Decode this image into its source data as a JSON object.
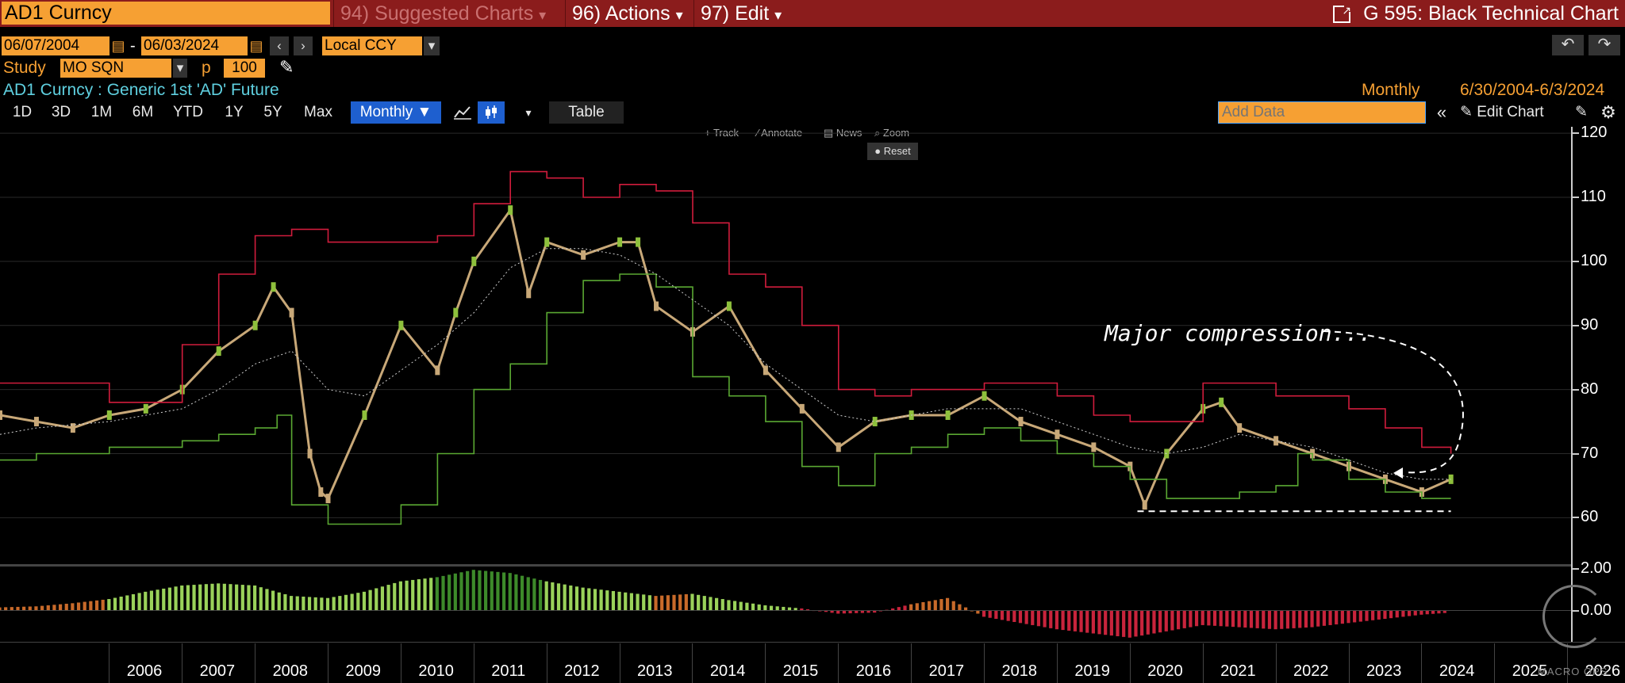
{
  "header": {
    "ticker": "AD1 Curncy",
    "suggested": "94) Suggested Charts",
    "actions": "96) Actions",
    "edit": "97) Edit",
    "chart_id": "G 595: Black Technical Chart",
    "arrow_down": "▾"
  },
  "range": {
    "start": "06/07/2004",
    "dash": "-",
    "end": "06/03/2024",
    "currency": "Local CCY",
    "prev": "‹",
    "next": "›"
  },
  "study": {
    "label": "Study",
    "value": "MO SQN",
    "p_label": "p",
    "p_value": "100"
  },
  "security": {
    "description": "AD1 Curncy : Generic 1st 'AD' Future",
    "period": "Monthly",
    "period_range": "6/30/2004-6/3/2024"
  },
  "toolbar": {
    "ranges": [
      "1D",
      "3D",
      "1M",
      "6M",
      "YTD",
      "1Y",
      "5Y",
      "Max"
    ],
    "frequency": "Monthly ▼",
    "table": "Table",
    "add_data_placeholder": "Add Data",
    "edit_chart": "Edit Chart"
  },
  "chart_tools": {
    "track": "Track",
    "annotate": "Annotate",
    "news": "News",
    "zoom": "Zoom",
    "reset": "Reset"
  },
  "annotation": "Major compression...",
  "watermark": "MACRO OPS",
  "colors": {
    "upper_band": "#d01c3c",
    "lower_band": "#5aa832",
    "candle_body": "#c8a878",
    "candle_up": "#8ec03c",
    "osc_green": "#9ad25a",
    "osc_dark_green": "#3d8a2a",
    "osc_orange": "#c86a2a",
    "osc_red": "#c8243c",
    "accent_orange": "#f6a033"
  },
  "chart_data": [
    {
      "type": "line",
      "title": "AD1 Curncy : Generic 1st 'AD' Future",
      "x_label": "",
      "y_label": "",
      "ylim": [
        53,
        121
      ],
      "y_ticks": [
        60,
        70,
        80,
        90,
        100,
        110,
        120
      ],
      "x_ticks": [
        "2006",
        "2007",
        "2008",
        "2009",
        "2010",
        "2011",
        "2012",
        "2013",
        "2014",
        "2015",
        "2016",
        "2017",
        "2018",
        "2019",
        "2020",
        "2021",
        "2022",
        "2023",
        "2024",
        "2025",
        "2026"
      ],
      "series": [
        {
          "kind": "close",
          "x": [
            2004.5,
            2005,
            2005.5,
            2006,
            2006.5,
            2007,
            2007.5,
            2008,
            2008.25,
            2008.5,
            2008.75,
            2008.9,
            2009,
            2009.5,
            2010,
            2010.5,
            2010.75,
            2011,
            2011.5,
            2011.75,
            2012,
            2012.5,
            2013,
            2013.25,
            2013.5,
            2014,
            2014.5,
            2015,
            2015.5,
            2016,
            2016.5,
            2017,
            2017.5,
            2018,
            2018.5,
            2019,
            2019.5,
            2020,
            2020.2,
            2020.5,
            2021,
            2021.25,
            2021.5,
            2022,
            2022.5,
            2023,
            2023.5,
            2024,
            2024.4
          ],
          "values": [
            76,
            75,
            74,
            76,
            77,
            80,
            86,
            90,
            96,
            92,
            70,
            64,
            63,
            76,
            90,
            83,
            92,
            100,
            108,
            95,
            103,
            101,
            103,
            103,
            93,
            89,
            93,
            83,
            77,
            71,
            75,
            76,
            76,
            79,
            75,
            73,
            71,
            68,
            62,
            70,
            77,
            78,
            74,
            72,
            70,
            68,
            66,
            64,
            66
          ]
        },
        {
          "kind": "upper_band",
          "x": [
            2004.5,
            2006,
            2007,
            2007.5,
            2008,
            2008.5,
            2009,
            2010,
            2010.5,
            2011,
            2011.5,
            2012,
            2012.5,
            2013,
            2013.5,
            2014,
            2014.5,
            2015,
            2015.5,
            2016,
            2016.5,
            2017,
            2017.5,
            2018,
            2018.5,
            2019,
            2019.5,
            2020,
            2020.5,
            2021,
            2021.5,
            2022,
            2022.5,
            2023,
            2023.5,
            2024,
            2024.4
          ],
          "values": [
            81,
            78,
            87,
            98,
            104,
            105,
            103,
            103,
            104,
            109,
            114,
            113,
            110,
            112,
            111,
            106,
            98,
            96,
            90,
            80,
            79,
            80,
            80,
            81,
            81,
            79,
            76,
            75,
            75,
            81,
            81,
            79,
            79,
            77,
            74,
            71,
            70
          ]
        },
        {
          "kind": "lower_band",
          "x": [
            2004.5,
            2005,
            2006,
            2007,
            2007.5,
            2008,
            2008.3,
            2008.5,
            2009,
            2009.5,
            2010,
            2010.5,
            2011,
            2011.5,
            2012,
            2012.5,
            2013,
            2013.5,
            2014,
            2014.5,
            2015,
            2015.5,
            2016,
            2016.5,
            2017,
            2017.5,
            2018,
            2018.5,
            2019,
            2019.5,
            2020,
            2020.5,
            2021,
            2021.5,
            2022,
            2022.3,
            2022.5,
            2023,
            2023.5,
            2024,
            2024.4
          ],
          "values": [
            69,
            70,
            71,
            72,
            73,
            74,
            76,
            62,
            59,
            59,
            62,
            70,
            80,
            84,
            92,
            97,
            98,
            96,
            82,
            79,
            75,
            68,
            65,
            70,
            71,
            73,
            74,
            72,
            70,
            68,
            66,
            63,
            63,
            64,
            65,
            70,
            69,
            66,
            64,
            63,
            63
          ]
        },
        {
          "kind": "moving_average",
          "x": [
            2004.5,
            2005,
            2006,
            2007,
            2007.5,
            2008,
            2008.5,
            2009,
            2009.5,
            2010,
            2010.5,
            2011,
            2011.5,
            2012,
            2012.5,
            2013,
            2013.5,
            2014,
            2014.5,
            2015,
            2015.5,
            2016,
            2016.5,
            2017,
            2017.5,
            2018,
            2018.5,
            2019,
            2019.5,
            2020,
            2020.5,
            2021,
            2021.5,
            2022,
            2022.5,
            2023,
            2023.5,
            2024,
            2024.4
          ],
          "values": [
            73,
            74,
            75,
            77,
            80,
            84,
            86,
            80,
            79,
            83,
            87,
            92,
            99,
            102,
            102,
            101,
            98,
            94,
            90,
            84,
            80,
            76,
            75,
            76,
            77,
            77,
            77,
            75,
            73,
            71,
            70,
            71,
            73,
            72,
            71,
            69,
            67,
            66,
            66
          ]
        },
        {
          "kind": "annotation_support",
          "x": [
            2020.1,
            2024.4
          ],
          "values": [
            61,
            61
          ]
        }
      ]
    },
    {
      "type": "bar",
      "title": "",
      "ylim": [
        -1.5,
        2.3
      ],
      "y_ticks": [
        2.0,
        0.0
      ],
      "y_tick_labels": [
        "2.00",
        "0.00"
      ],
      "x": [
        2004.5,
        2005,
        2005.5,
        2006,
        2006.5,
        2007,
        2007.5,
        2008,
        2008.5,
        2009,
        2009.5,
        2010,
        2010.5,
        2011,
        2011.5,
        2012,
        2012.5,
        2013,
        2013.5,
        2014,
        2014.5,
        2015,
        2015.5,
        2016,
        2016.5,
        2017,
        2017.5,
        2018,
        2018.5,
        2019,
        2019.5,
        2020,
        2020.5,
        2021,
        2021.5,
        2022,
        2022.5,
        2023,
        2023.5,
        2024,
        2024.4
      ],
      "values": [
        0.15,
        0.2,
        0.35,
        0.55,
        0.9,
        1.2,
        1.3,
        1.2,
        0.7,
        0.6,
        0.9,
        1.4,
        1.6,
        1.95,
        1.8,
        1.4,
        1.1,
        0.9,
        0.7,
        0.8,
        0.5,
        0.25,
        0.1,
        -0.15,
        -0.1,
        0.3,
        0.6,
        -0.3,
        -0.6,
        -0.9,
        -1.1,
        -1.3,
        -1.0,
        -0.7,
        -0.8,
        -0.9,
        -0.8,
        -0.6,
        -0.4,
        -0.2,
        -0.1
      ],
      "colors_by_index": [
        "orange",
        "orange",
        "orange",
        "green",
        "green",
        "green",
        "green",
        "green",
        "green",
        "green",
        "green",
        "green",
        "dark_green",
        "dark_green",
        "dark_green",
        "green",
        "green",
        "green",
        "orange",
        "green",
        "green",
        "green",
        "red",
        "red",
        "red",
        "orange",
        "orange",
        "red",
        "red",
        "red",
        "red",
        "red",
        "red",
        "red",
        "red",
        "red",
        "red",
        "red",
        "red",
        "red",
        "red"
      ]
    }
  ]
}
